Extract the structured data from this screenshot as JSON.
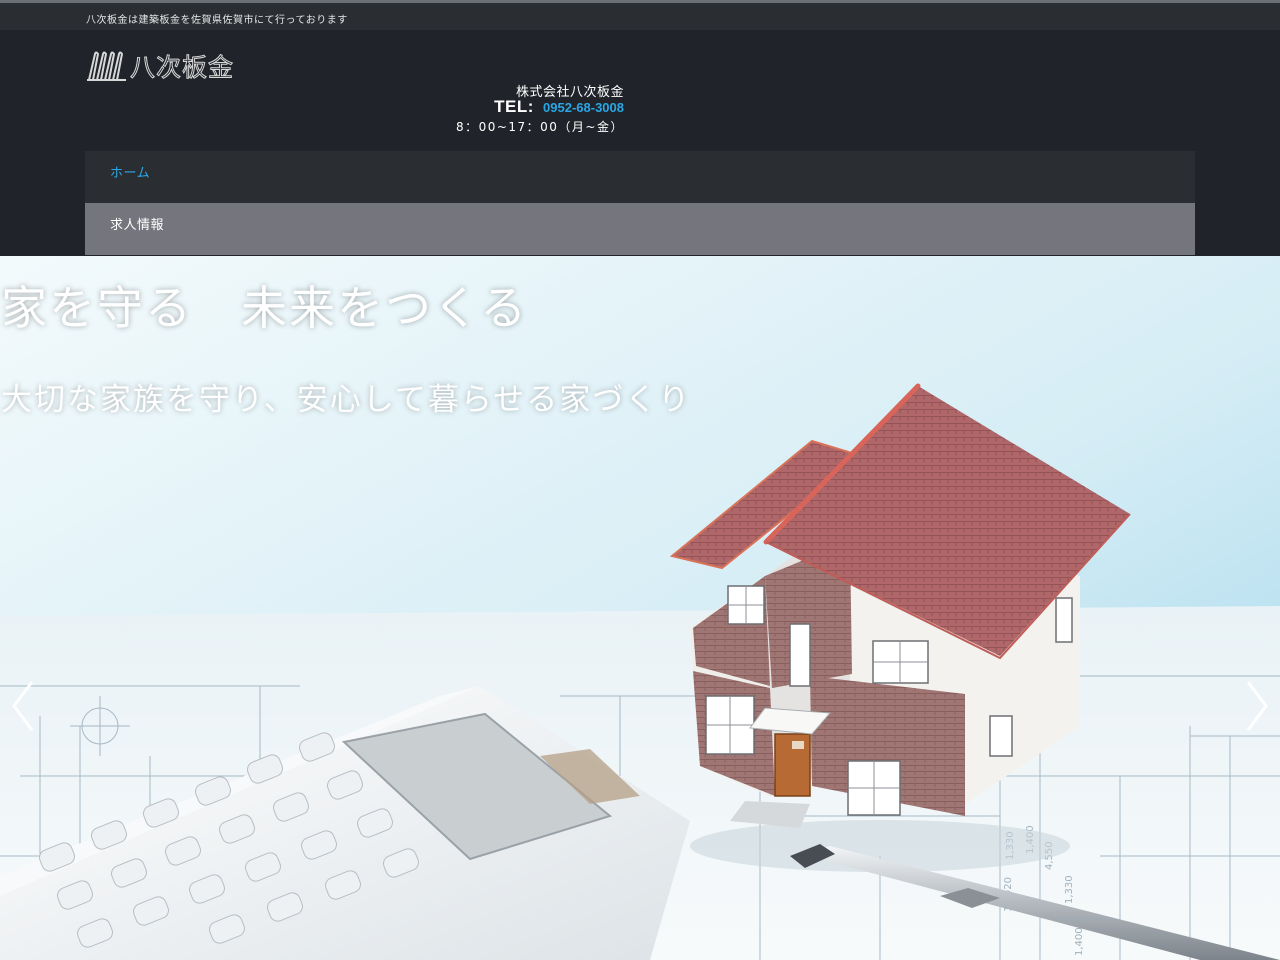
{
  "topbar": {
    "tagline": "八次板金は建築板金を佐賀県佐賀市にて行っております"
  },
  "header": {
    "logo_text": "八次板金",
    "company_name": "株式会社八次板金",
    "tel_label": "TEL:",
    "tel_number": "0952-68-3008",
    "hours": "8：00~17：00（月~金）"
  },
  "nav": {
    "items": [
      {
        "label": "ホーム",
        "active": true
      },
      {
        "label": "求人情報",
        "active": false
      }
    ]
  },
  "hero": {
    "title": "家を守る　未来をつくる",
    "subtitle": "大切な家族を守り、安心して暮らせる家づくり",
    "prev_icon": "chevron-left-icon",
    "next_icon": "chevron-right-icon"
  },
  "colors": {
    "header_bg": "#20242a",
    "accent_blue": "#2aa6e6",
    "nav_jobs_bg": "#75757d"
  }
}
